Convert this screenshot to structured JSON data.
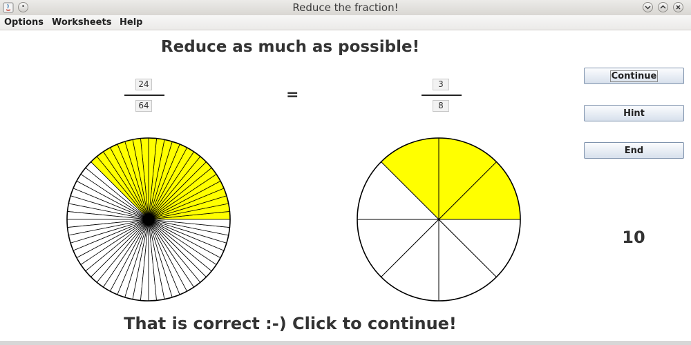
{
  "window": {
    "title": "Reduce the fraction!"
  },
  "menu": {
    "items": [
      "Options",
      "Worksheets",
      "Help"
    ]
  },
  "heading": "Reduce as much as possible!",
  "left_fraction": {
    "numerator": "24",
    "denominator": "64",
    "pie": {
      "slices": 64,
      "filled": 24
    }
  },
  "equals": "=",
  "right_fraction": {
    "numerator": "3",
    "denominator": "8",
    "pie": {
      "slices": 8,
      "filled": 3
    }
  },
  "buttons": {
    "continue": "Continue",
    "hint": "Hint",
    "end": "End"
  },
  "score": "10",
  "status": "That is correct :-) Click to continue!",
  "colors": {
    "fill": "#ffff00",
    "empty": "#ffffff",
    "stroke": "#000000"
  }
}
